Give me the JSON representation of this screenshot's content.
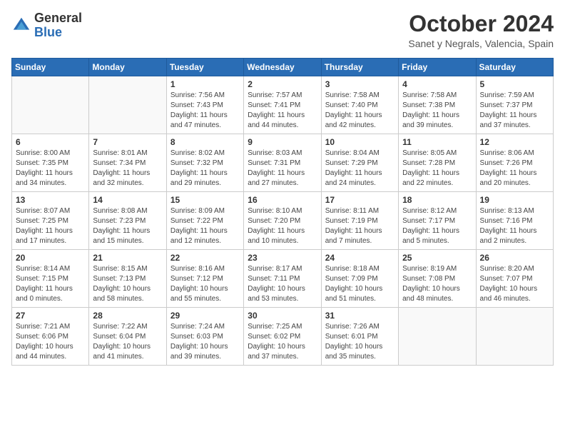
{
  "header": {
    "logo": {
      "general": "General",
      "blue": "Blue"
    },
    "title": "October 2024",
    "subtitle": "Sanet y Negrals, Valencia, Spain"
  },
  "days_of_week": [
    "Sunday",
    "Monday",
    "Tuesday",
    "Wednesday",
    "Thursday",
    "Friday",
    "Saturday"
  ],
  "weeks": [
    {
      "days": [
        {
          "number": "",
          "info": ""
        },
        {
          "number": "",
          "info": ""
        },
        {
          "number": "1",
          "info": "Sunrise: 7:56 AM\nSunset: 7:43 PM\nDaylight: 11 hours and 47 minutes."
        },
        {
          "number": "2",
          "info": "Sunrise: 7:57 AM\nSunset: 7:41 PM\nDaylight: 11 hours and 44 minutes."
        },
        {
          "number": "3",
          "info": "Sunrise: 7:58 AM\nSunset: 7:40 PM\nDaylight: 11 hours and 42 minutes."
        },
        {
          "number": "4",
          "info": "Sunrise: 7:58 AM\nSunset: 7:38 PM\nDaylight: 11 hours and 39 minutes."
        },
        {
          "number": "5",
          "info": "Sunrise: 7:59 AM\nSunset: 7:37 PM\nDaylight: 11 hours and 37 minutes."
        }
      ]
    },
    {
      "days": [
        {
          "number": "6",
          "info": "Sunrise: 8:00 AM\nSunset: 7:35 PM\nDaylight: 11 hours and 34 minutes."
        },
        {
          "number": "7",
          "info": "Sunrise: 8:01 AM\nSunset: 7:34 PM\nDaylight: 11 hours and 32 minutes."
        },
        {
          "number": "8",
          "info": "Sunrise: 8:02 AM\nSunset: 7:32 PM\nDaylight: 11 hours and 29 minutes."
        },
        {
          "number": "9",
          "info": "Sunrise: 8:03 AM\nSunset: 7:31 PM\nDaylight: 11 hours and 27 minutes."
        },
        {
          "number": "10",
          "info": "Sunrise: 8:04 AM\nSunset: 7:29 PM\nDaylight: 11 hours and 24 minutes."
        },
        {
          "number": "11",
          "info": "Sunrise: 8:05 AM\nSunset: 7:28 PM\nDaylight: 11 hours and 22 minutes."
        },
        {
          "number": "12",
          "info": "Sunrise: 8:06 AM\nSunset: 7:26 PM\nDaylight: 11 hours and 20 minutes."
        }
      ]
    },
    {
      "days": [
        {
          "number": "13",
          "info": "Sunrise: 8:07 AM\nSunset: 7:25 PM\nDaylight: 11 hours and 17 minutes."
        },
        {
          "number": "14",
          "info": "Sunrise: 8:08 AM\nSunset: 7:23 PM\nDaylight: 11 hours and 15 minutes."
        },
        {
          "number": "15",
          "info": "Sunrise: 8:09 AM\nSunset: 7:22 PM\nDaylight: 11 hours and 12 minutes."
        },
        {
          "number": "16",
          "info": "Sunrise: 8:10 AM\nSunset: 7:20 PM\nDaylight: 11 hours and 10 minutes."
        },
        {
          "number": "17",
          "info": "Sunrise: 8:11 AM\nSunset: 7:19 PM\nDaylight: 11 hours and 7 minutes."
        },
        {
          "number": "18",
          "info": "Sunrise: 8:12 AM\nSunset: 7:17 PM\nDaylight: 11 hours and 5 minutes."
        },
        {
          "number": "19",
          "info": "Sunrise: 8:13 AM\nSunset: 7:16 PM\nDaylight: 11 hours and 2 minutes."
        }
      ]
    },
    {
      "days": [
        {
          "number": "20",
          "info": "Sunrise: 8:14 AM\nSunset: 7:15 PM\nDaylight: 11 hours and 0 minutes."
        },
        {
          "number": "21",
          "info": "Sunrise: 8:15 AM\nSunset: 7:13 PM\nDaylight: 10 hours and 58 minutes."
        },
        {
          "number": "22",
          "info": "Sunrise: 8:16 AM\nSunset: 7:12 PM\nDaylight: 10 hours and 55 minutes."
        },
        {
          "number": "23",
          "info": "Sunrise: 8:17 AM\nSunset: 7:11 PM\nDaylight: 10 hours and 53 minutes."
        },
        {
          "number": "24",
          "info": "Sunrise: 8:18 AM\nSunset: 7:09 PM\nDaylight: 10 hours and 51 minutes."
        },
        {
          "number": "25",
          "info": "Sunrise: 8:19 AM\nSunset: 7:08 PM\nDaylight: 10 hours and 48 minutes."
        },
        {
          "number": "26",
          "info": "Sunrise: 8:20 AM\nSunset: 7:07 PM\nDaylight: 10 hours and 46 minutes."
        }
      ]
    },
    {
      "days": [
        {
          "number": "27",
          "info": "Sunrise: 7:21 AM\nSunset: 6:06 PM\nDaylight: 10 hours and 44 minutes."
        },
        {
          "number": "28",
          "info": "Sunrise: 7:22 AM\nSunset: 6:04 PM\nDaylight: 10 hours and 41 minutes."
        },
        {
          "number": "29",
          "info": "Sunrise: 7:24 AM\nSunset: 6:03 PM\nDaylight: 10 hours and 39 minutes."
        },
        {
          "number": "30",
          "info": "Sunrise: 7:25 AM\nSunset: 6:02 PM\nDaylight: 10 hours and 37 minutes."
        },
        {
          "number": "31",
          "info": "Sunrise: 7:26 AM\nSunset: 6:01 PM\nDaylight: 10 hours and 35 minutes."
        },
        {
          "number": "",
          "info": ""
        },
        {
          "number": "",
          "info": ""
        }
      ]
    }
  ]
}
